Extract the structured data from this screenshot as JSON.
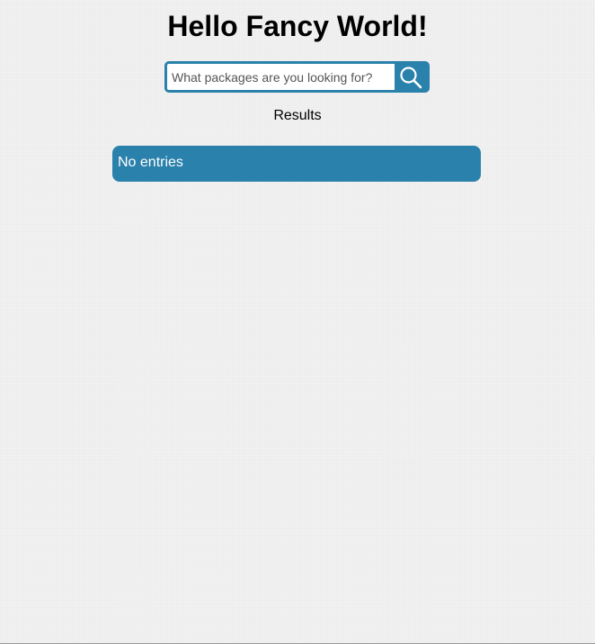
{
  "header": {
    "title": "Hello Fancy World!"
  },
  "search": {
    "placeholder": "What packages are you looking for?",
    "value": "",
    "button_icon": "search-icon"
  },
  "results": {
    "label": "Results",
    "empty_message": "No entries"
  },
  "colors": {
    "accent": "#2a81ab",
    "background": "#f4f4f4",
    "text": "#000000",
    "results_text": "#ffffff"
  }
}
